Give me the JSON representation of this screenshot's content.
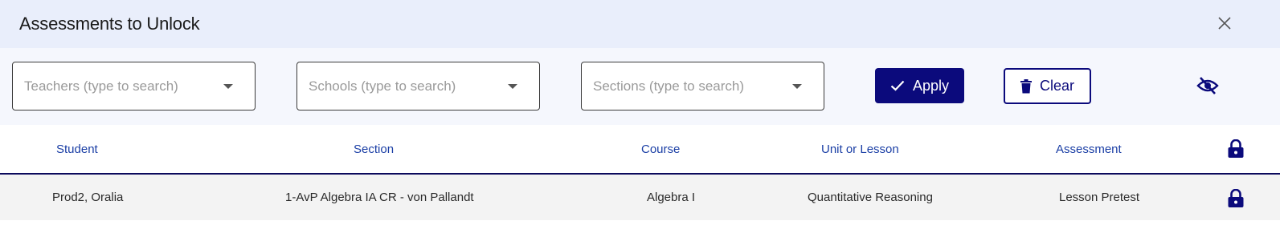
{
  "modal": {
    "title": "Assessments to Unlock",
    "close_icon": "close-icon"
  },
  "filters": {
    "teachers_placeholder": "Teachers (type to search)",
    "schools_placeholder": "Schools (type to search)",
    "sections_placeholder": "Sections (type to search)",
    "apply_label": "Apply",
    "clear_label": "Clear",
    "visibility_icon": "eye-off-icon"
  },
  "table": {
    "headers": {
      "student": "Student",
      "section": "Section",
      "course": "Course",
      "unit": "Unit or Lesson",
      "assessment": "Assessment"
    },
    "rows": [
      {
        "student": "Prod2, Oralia",
        "section": "1-AvP Algebra IA CR - von Pallandt",
        "course": "Algebra I",
        "unit": "Quantitative Reasoning",
        "assessment": "Lesson Pretest",
        "lock_icon": "lock-icon"
      }
    ]
  },
  "colors": {
    "primary": "#0b0a7c",
    "header_bg": "#e9eefb",
    "filter_bg": "#f5f7fd",
    "column_header_text": "#1a3ea5",
    "row_bg": "#f3f3f3"
  }
}
